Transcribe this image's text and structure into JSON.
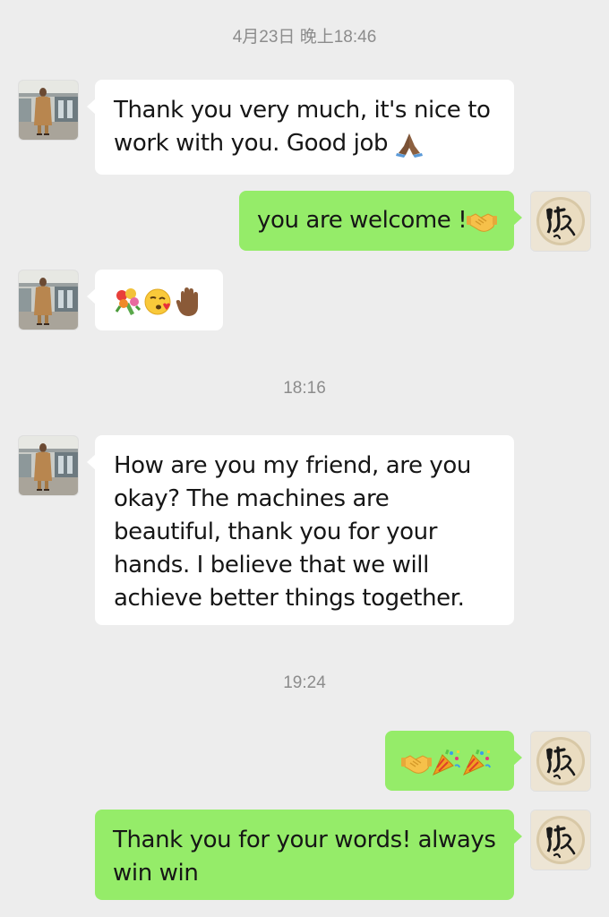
{
  "chat": {
    "timestamps": [
      "4月23日 晚上18:46",
      "18:16",
      "19:24"
    ],
    "messages": [
      {
        "sender": "contact",
        "text": "Thank you very much, it's nice to work with you. Good job",
        "emoji": [
          "folded-hands"
        ]
      },
      {
        "sender": "me",
        "text": "you are welcome !",
        "emoji": [
          "handshake"
        ]
      },
      {
        "sender": "contact",
        "text": "",
        "emoji": [
          "bouquet",
          "face-blowing-kiss",
          "raised-hand"
        ]
      },
      {
        "sender": "contact",
        "text": "How are you my friend, are you okay? The machines are beautiful, thank you for your hands. I believe that we will achieve better things together.",
        "emoji": []
      },
      {
        "sender": "me",
        "text": "",
        "emoji": [
          "handshake",
          "party-popper",
          "party-popper"
        ]
      },
      {
        "sender": "me",
        "text": "Thank you for your words! always win win",
        "emoji": []
      }
    ]
  },
  "colors": {
    "background": "#ededed",
    "incoming_bubble": "#ffffff",
    "outgoing_bubble": "#95ec69",
    "timestamp_text": "#8c8c8c"
  },
  "icons": {
    "contact_avatar": "person-photo-avatar",
    "my_avatar": "calligraphy-seal-avatar"
  }
}
